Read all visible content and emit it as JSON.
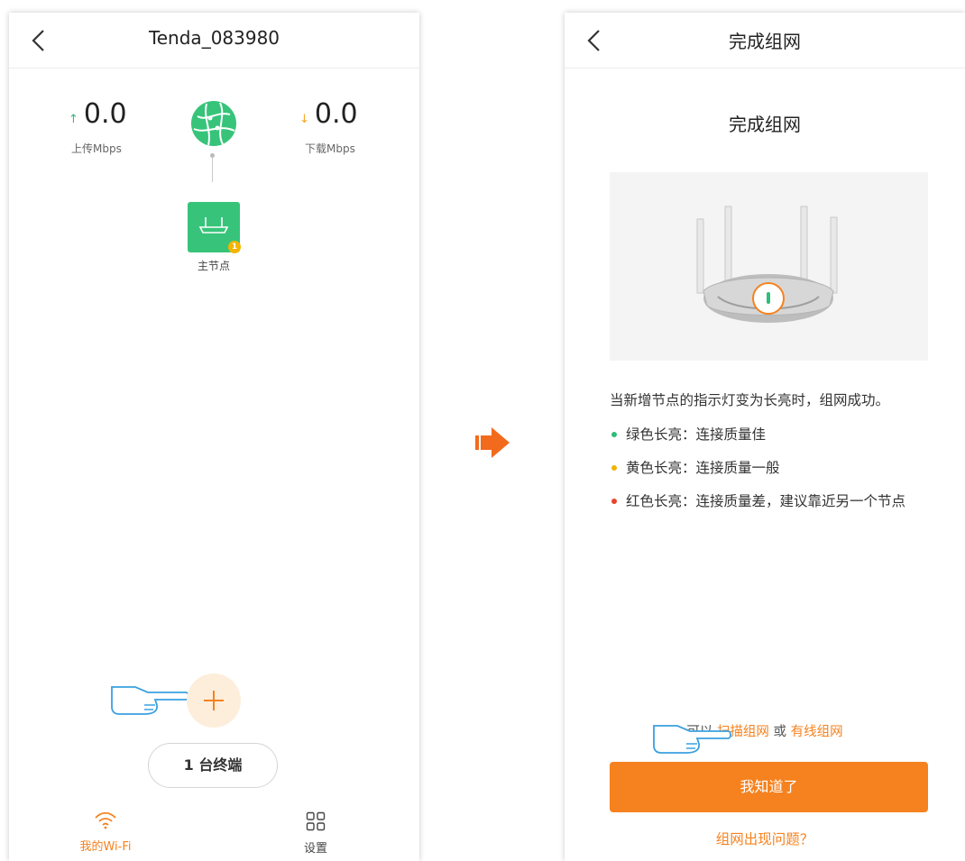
{
  "left": {
    "title": "Tenda_083980",
    "upload": {
      "value": "0.0",
      "label": "上传Mbps"
    },
    "download": {
      "value": "0.0",
      "label": "下载Mbps"
    },
    "node": {
      "label": "主节点",
      "badge": "1"
    },
    "terminal_button": "1 台终端",
    "tabs": [
      {
        "label": "我的Wi-Fi",
        "icon": "wifi-icon",
        "active": true
      },
      {
        "label": "设置",
        "icon": "settings-grid-icon",
        "active": false
      }
    ]
  },
  "right": {
    "title": "完成组网",
    "heading": "完成组网",
    "instruction": "当新增节点的指示灯变为长亮时，组网成功。",
    "statuses": [
      {
        "text": "绿色长亮：连接质量佳",
        "color": "#2ebd7a"
      },
      {
        "text": "黄色长亮：连接质量一般",
        "color": "#f0b400"
      },
      {
        "text": "红色长亮：连接质量差，建议靠近另一个节点",
        "color": "#e8452c"
      }
    ],
    "alt_prefix": "可以",
    "alt_scan": "扫描组网",
    "alt_or": "或",
    "alt_wired": "有线组网",
    "ok_button": "我知道了",
    "problem_link": "组网出现问题？"
  },
  "colors": {
    "accent": "#f5821f",
    "node_green": "#37c47a"
  }
}
